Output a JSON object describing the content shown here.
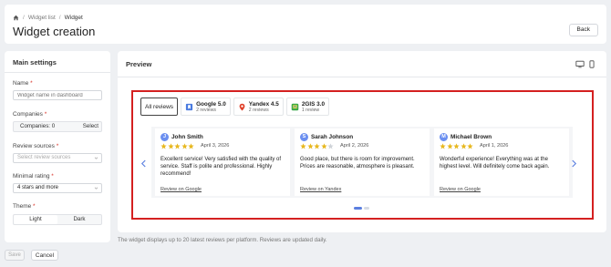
{
  "breadcrumb": {
    "items": [
      "Widget list",
      "Widget"
    ]
  },
  "header": {
    "title": "Widget creation",
    "back_label": "Back"
  },
  "settings": {
    "title": "Main settings",
    "name": {
      "label": "Name",
      "placeholder": "Widget name in dashboard"
    },
    "companies": {
      "label": "Companies",
      "value": "Companies: 0",
      "select_label": "Select"
    },
    "review_sources": {
      "label": "Review sources",
      "placeholder": "Select review sources"
    },
    "minimal_rating": {
      "label": "Minimal rating",
      "value": "4 stars and more"
    },
    "theme": {
      "label": "Theme",
      "options": [
        "Light",
        "Dark"
      ],
      "selected": "Light"
    }
  },
  "actions": {
    "save_label": "Save",
    "cancel_label": "Cancel"
  },
  "preview": {
    "title": "Preview",
    "tabs": [
      {
        "label": "All reviews"
      },
      {
        "name": "Google",
        "rating": "5.0",
        "count": "2 reviews",
        "color": "#4a7be0"
      },
      {
        "name": "Yandex",
        "rating": "4.5",
        "count": "2 reviews",
        "color": "#e0402a"
      },
      {
        "name": "2GIS",
        "rating": "3.0",
        "count": "1 review",
        "color": "#3ca84a"
      }
    ],
    "reviews": [
      {
        "initial": "J",
        "name": "John Smith",
        "rating": 5,
        "date": "April 3, 2026",
        "text": "Excellent service! Very satisfied with the quality of service. Staff is polite and professional. Highly recommend!",
        "link": "Review on Google"
      },
      {
        "initial": "S",
        "name": "Sarah Johnson",
        "rating": 4,
        "date": "April 2, 2026",
        "text": "Good place, but there is room for improvement. Prices are reasonable, atmosphere is pleasant.",
        "link": "Review on Yandex"
      },
      {
        "initial": "M",
        "name": "Michael Brown",
        "rating": 5,
        "date": "April 1, 2026",
        "text": "Wonderful experience! Everything was at the highest level. Will definitely come back again.",
        "link": "Review on Google"
      }
    ],
    "note": "The widget displays up to 20 latest reviews per platform. Reviews are updated daily."
  },
  "colors": {
    "star": "#e8b820",
    "star_empty": "#cfd3d8",
    "accent": "#5b7fe0",
    "highlight_border": "#d42020"
  }
}
